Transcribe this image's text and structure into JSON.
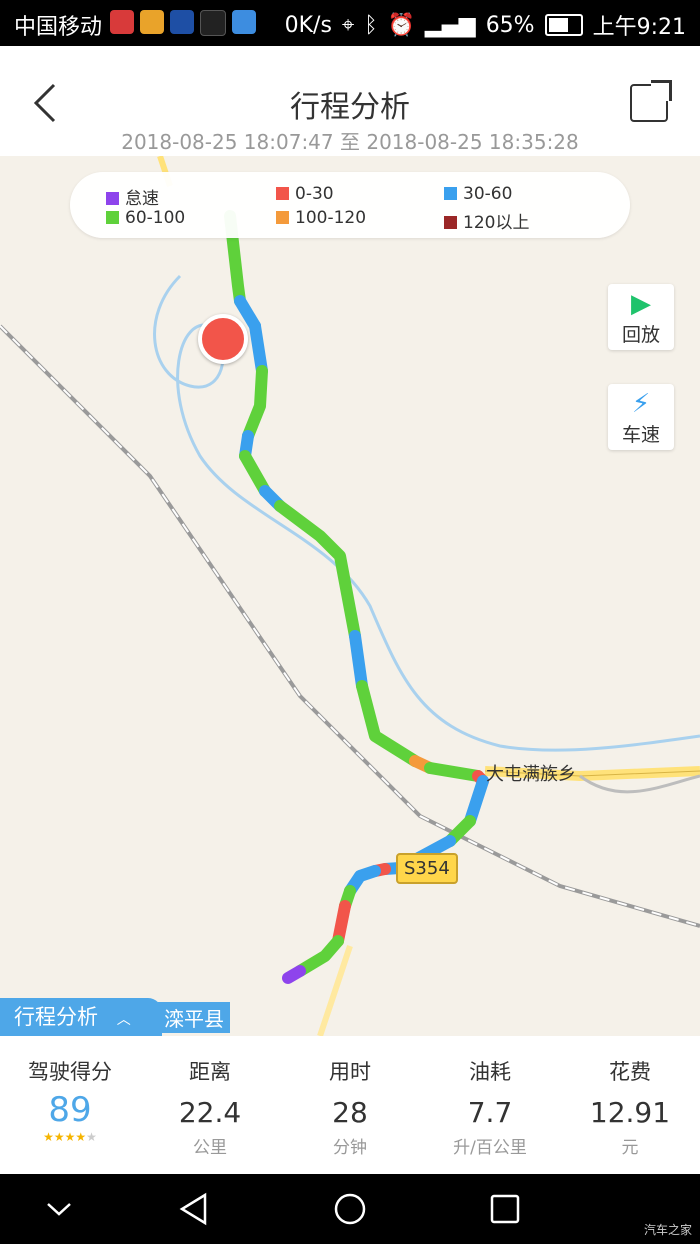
{
  "status_bar": {
    "carrier": "中国移动",
    "network_speed": "0K/s",
    "battery": "65%",
    "battery_level": 0.65,
    "time": "上午9:21"
  },
  "header": {
    "title": "行程分析",
    "time_range": "2018-08-25 18:07:47 至 2018-08-25 18:35:28",
    "back_icon": "chevron-left-icon",
    "share_icon": "share-icon"
  },
  "legend": [
    {
      "label": "怠速",
      "color": "#8e44ec"
    },
    {
      "label": "0-30",
      "color": "#f2554a"
    },
    {
      "label": "30-60",
      "color": "#3aa0ee"
    },
    {
      "label": "60-100",
      "color": "#5fd13b"
    },
    {
      "label": "100-120",
      "color": "#f49a3b"
    },
    {
      "label": "120以上",
      "color": "#9b2727"
    }
  ],
  "side_buttons": {
    "replay": "回放",
    "speed": "车速"
  },
  "map": {
    "town_label": "大屯满族乡",
    "road_shield": "S354",
    "start_pin": "起",
    "county_label": "滦平县"
  },
  "tab": {
    "label": "行程分析"
  },
  "stats": [
    {
      "label": "驾驶得分",
      "value": "89",
      "stars": 4,
      "unit": ""
    },
    {
      "label": "距离",
      "value": "22.4",
      "unit": "公里"
    },
    {
      "label": "用时",
      "value": "28",
      "unit": "分钟"
    },
    {
      "label": "油耗",
      "value": "7.7",
      "unit": "升/百公里"
    },
    {
      "label": "花费",
      "value": "12.91",
      "unit": "元"
    }
  ],
  "watermark": "汽车之家"
}
